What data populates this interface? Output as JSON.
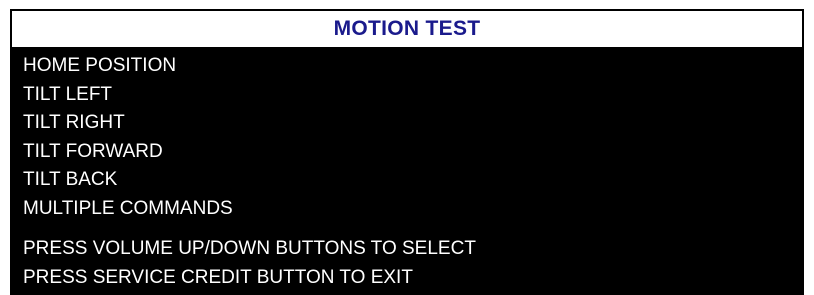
{
  "screen": {
    "title": "MOTION TEST",
    "title_color": "#1a1a8c",
    "background": "#000000",
    "text_color": "#ffffff"
  },
  "menu": {
    "items": [
      {
        "label": "HOME POSITION"
      },
      {
        "label": "TILT LEFT"
      },
      {
        "label": "TILT RIGHT"
      },
      {
        "label": "TILT FORWARD"
      },
      {
        "label": "TILT BACK"
      },
      {
        "label": "MULTIPLE COMMANDS"
      }
    ]
  },
  "instructions": {
    "select": "PRESS VOLUME UP/DOWN BUTTONS TO SELECT",
    "exit": "PRESS SERVICE CREDIT BUTTON TO EXIT"
  }
}
